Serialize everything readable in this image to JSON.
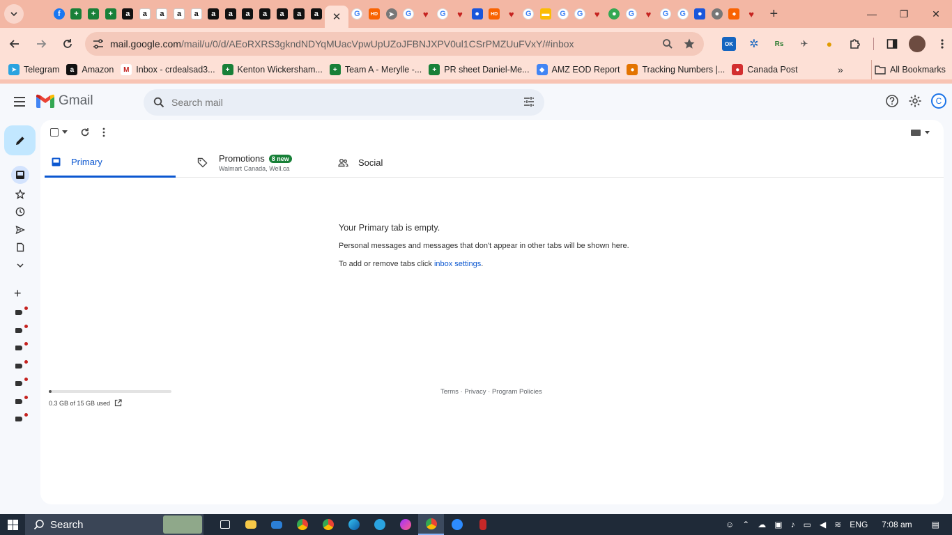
{
  "browser": {
    "url_host": "mail.google.com",
    "url_path": "/mail/u/0/d/AEoRXRS3gkndNDYqMUacVpwUpUZoJFBNJXPV0ul1CSrPMZUuFVxY/#inbox",
    "tabs": [
      {
        "icon": "gmail-icon",
        "glyph": "M",
        "cls": "gmail"
      },
      {
        "icon": "facebook-icon",
        "glyph": "f",
        "cls": "fb"
      },
      {
        "icon": "sheets-icon",
        "glyph": "+",
        "cls": "sheet"
      },
      {
        "icon": "sheets-icon",
        "glyph": "+",
        "cls": "sheet"
      },
      {
        "icon": "sheets-icon",
        "glyph": "+",
        "cls": "sheet"
      },
      {
        "icon": "amazon-icon",
        "glyph": "a",
        "cls": "amzd"
      },
      {
        "icon": "amazon-icon",
        "glyph": "a",
        "cls": "amz"
      },
      {
        "icon": "amazon-icon",
        "glyph": "a",
        "cls": "amz"
      },
      {
        "icon": "amazon-icon",
        "glyph": "a",
        "cls": "amz"
      },
      {
        "icon": "amazon-icon",
        "glyph": "a",
        "cls": "amz"
      },
      {
        "icon": "amazon-icon",
        "glyph": "a",
        "cls": "amzd"
      },
      {
        "icon": "amazon-icon",
        "glyph": "a",
        "cls": "amzd"
      },
      {
        "icon": "amazon-icon",
        "glyph": "a",
        "cls": "amzd"
      },
      {
        "icon": "amazon-icon",
        "glyph": "a",
        "cls": "amzd"
      },
      {
        "icon": "amazon-icon",
        "glyph": "a",
        "cls": "amzd"
      },
      {
        "icon": "amazon-icon",
        "glyph": "a",
        "cls": "amzd"
      },
      {
        "icon": "amazon-icon",
        "glyph": "a",
        "cls": "amzd"
      }
    ],
    "tabs_after": [
      {
        "icon": "google-icon",
        "glyph": "G",
        "cls": "goog"
      },
      {
        "icon": "home-depot-icon",
        "glyph": "HD",
        "cls": "hd"
      },
      {
        "icon": "arrow-icon",
        "glyph": "➤",
        "cls": "grey"
      },
      {
        "icon": "google-icon",
        "glyph": "G",
        "cls": "goog"
      },
      {
        "icon": "heart-icon",
        "glyph": "♥",
        "cls": "red"
      },
      {
        "icon": "google-icon",
        "glyph": "G",
        "cls": "goog"
      },
      {
        "icon": "heart-icon",
        "glyph": "♥",
        "cls": "red"
      },
      {
        "icon": "canada-post-icon",
        "glyph": "●",
        "cls": "blue"
      },
      {
        "icon": "home-depot-icon",
        "glyph": "HD",
        "cls": "hd"
      },
      {
        "icon": "heart-icon",
        "glyph": "♥",
        "cls": "red"
      },
      {
        "icon": "google-icon",
        "glyph": "G",
        "cls": "goog"
      },
      {
        "icon": "tag-icon",
        "glyph": "▬",
        "cls": "yel"
      },
      {
        "icon": "google-icon",
        "glyph": "G",
        "cls": "goog"
      },
      {
        "icon": "google-icon",
        "glyph": "G",
        "cls": "goog"
      },
      {
        "icon": "heart-icon",
        "glyph": "♥",
        "cls": "red"
      },
      {
        "icon": "leaf-icon",
        "glyph": "●",
        "cls": "grn"
      },
      {
        "icon": "google-icon",
        "glyph": "G",
        "cls": "goog"
      },
      {
        "icon": "heart-icon",
        "glyph": "♥",
        "cls": "red"
      },
      {
        "icon": "google-icon",
        "glyph": "G",
        "cls": "goog"
      },
      {
        "icon": "google-icon",
        "glyph": "G",
        "cls": "goog"
      },
      {
        "icon": "person-icon",
        "glyph": "●",
        "cls": "blue"
      },
      {
        "icon": "extension-icon",
        "glyph": "●",
        "cls": "grey"
      },
      {
        "icon": "ads-icon",
        "glyph": "◆",
        "cls": "hd"
      },
      {
        "icon": "heart-icon",
        "glyph": "♥",
        "cls": "red"
      }
    ],
    "ext_ok_label": "OK",
    "ext_rs_label": "Rs"
  },
  "bookmarks": [
    {
      "label": "Telegram",
      "color": "#2aa3e0",
      "glyph": "➤"
    },
    {
      "label": "Amazon",
      "color": "#111111",
      "glyph": "a"
    },
    {
      "label": "Inbox - crdealsad3...",
      "color": "#ffffff",
      "glyph": "M"
    },
    {
      "label": "Kenton Wickersham...",
      "color": "#188038",
      "glyph": "+"
    },
    {
      "label": "Team A - Merylle -...",
      "color": "#188038",
      "glyph": "+"
    },
    {
      "label": "PR sheet Daniel-Me...",
      "color": "#188038",
      "glyph": "+"
    },
    {
      "label": "AMZ EOD Report",
      "color": "#4285f4",
      "glyph": "◆"
    },
    {
      "label": "Tracking Numbers |...",
      "color": "#e37400",
      "glyph": "●"
    },
    {
      "label": "Canada Post",
      "color": "#d32f2f",
      "glyph": "●"
    }
  ],
  "bookmarks_all": "All Bookmarks",
  "gmail": {
    "logo_text": "Gmail",
    "search_placeholder": "Search mail",
    "avatar_letter": "C",
    "tabs": {
      "primary": "Primary",
      "promotions": "Promotions",
      "promotions_badge": "8 new",
      "promotions_sub": "Walmart Canada, Well.ca",
      "social": "Social"
    },
    "empty": {
      "heading": "Your Primary tab is empty.",
      "line1": "Personal messages and messages that don't appear in other tabs will be shown here.",
      "line2_prefix": "To add or remove tabs click ",
      "line2_link": "inbox settings",
      "line2_suffix": "."
    },
    "storage": {
      "text": "0.3 GB of 15 GB used",
      "fraction": 0.02
    },
    "footer": {
      "terms": "Terms",
      "sep": " · ",
      "privacy": "Privacy",
      "policies": "Program Policies"
    },
    "label_count": 7
  },
  "taskbar": {
    "search_label": "Search",
    "lang": "ENG",
    "time": "7:08 am"
  },
  "colors": {
    "accent": "#0b57d0",
    "compose": "#c2e7ff",
    "promo_badge": "#188038"
  }
}
